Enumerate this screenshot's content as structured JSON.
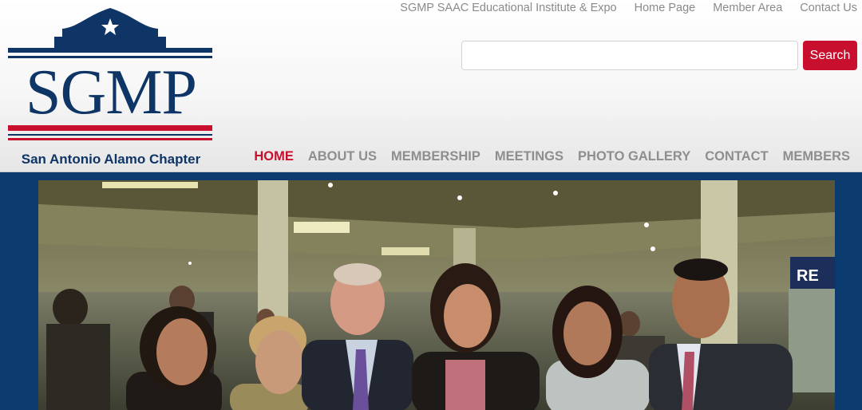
{
  "logo": {
    "letters": "SGMP",
    "subtitle": "San Antonio Alamo Chapter",
    "colors": {
      "navy": "#0f3566",
      "red": "#c8102e"
    }
  },
  "top_links": [
    "SGMP SAAC Educational Institute & Expo",
    "Home Page",
    "Member Area",
    "Contact Us"
  ],
  "search": {
    "placeholder": "",
    "button_label": "Search"
  },
  "nav": [
    {
      "label": "HOME",
      "active": true
    },
    {
      "label": "ABOUT US",
      "active": false
    },
    {
      "label": "MEMBERSHIP",
      "active": false
    },
    {
      "label": "MEETINGS",
      "active": false
    },
    {
      "label": "PHOTO GALLERY",
      "active": false
    },
    {
      "label": "CONTACT",
      "active": false
    },
    {
      "label": "MEMBERS",
      "active": false
    }
  ],
  "hero": {
    "booth_sign": "RE"
  },
  "colors": {
    "accent": "#c8102e",
    "background": "#0b3a6e",
    "nav_text": "#8e8e8e"
  }
}
